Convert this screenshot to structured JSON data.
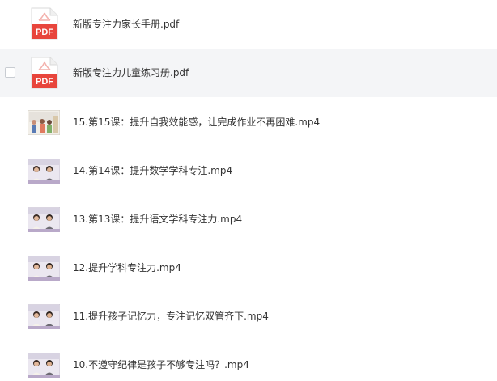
{
  "files": [
    {
      "name": "新版专注力家长手册.pdf",
      "type": "pdf",
      "icon": "pdf-icon",
      "icon_text": "PDF"
    },
    {
      "name": "新版专注力儿童练习册.pdf",
      "type": "pdf",
      "icon": "pdf-icon",
      "icon_text": "PDF",
      "hover": true
    },
    {
      "name": "15.第15课：提升自我效能感，让完成作业不再困难.mp4",
      "type": "video",
      "icon": "video-thumbnail"
    },
    {
      "name": "14.第14课：提升数学学科专注.mp4",
      "type": "video",
      "icon": "video-thumbnail"
    },
    {
      "name": "13.第13课：提升语文学科专注力.mp4",
      "type": "video",
      "icon": "video-thumbnail"
    },
    {
      "name": "12.提升学科专注力.mp4",
      "type": "video",
      "icon": "video-thumbnail"
    },
    {
      "name": "11.提升孩子记忆力，专注记忆双管齐下.mp4",
      "type": "video",
      "icon": "video-thumbnail"
    },
    {
      "name": "10.不遵守纪律是孩子不够专注吗？.mp4",
      "type": "video",
      "icon": "video-thumbnail"
    }
  ],
  "colors": {
    "pdf_red": "#e8453c",
    "hover_bg": "#f4f5f7",
    "text": "#333333"
  }
}
